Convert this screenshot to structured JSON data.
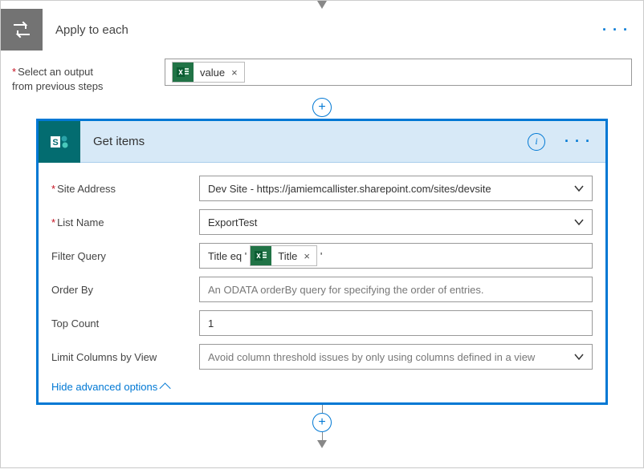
{
  "applyToEach": {
    "title": "Apply to each",
    "selectLabelLine1": "Select an output",
    "selectLabelLine2": "from previous steps",
    "tokenValueLabel": "value"
  },
  "getItems": {
    "title": "Get items",
    "labels": {
      "siteAddress": "Site Address",
      "listName": "List Name",
      "filterQuery": "Filter Query",
      "orderBy": "Order By",
      "topCount": "Top Count",
      "limitColumns": "Limit Columns by View"
    },
    "values": {
      "siteAddress": "Dev Site - https://jamiemcallister.sharepoint.com/sites/devsite",
      "listName": "ExportTest",
      "filterQueryPrefix": "Title eq '",
      "filterQuerySuffix": "'",
      "filterTokenLabel": "Title",
      "orderByPlaceholder": "An ODATA orderBy query for specifying the order of entries.",
      "topCount": "1",
      "limitColumnsPlaceholder": "Avoid column threshold issues by only using columns defined in a view"
    },
    "hideAdvanced": "Hide advanced options"
  },
  "glyphs": {
    "ellipsis": "· · ·",
    "plus": "+",
    "close": "×",
    "info": "i"
  }
}
